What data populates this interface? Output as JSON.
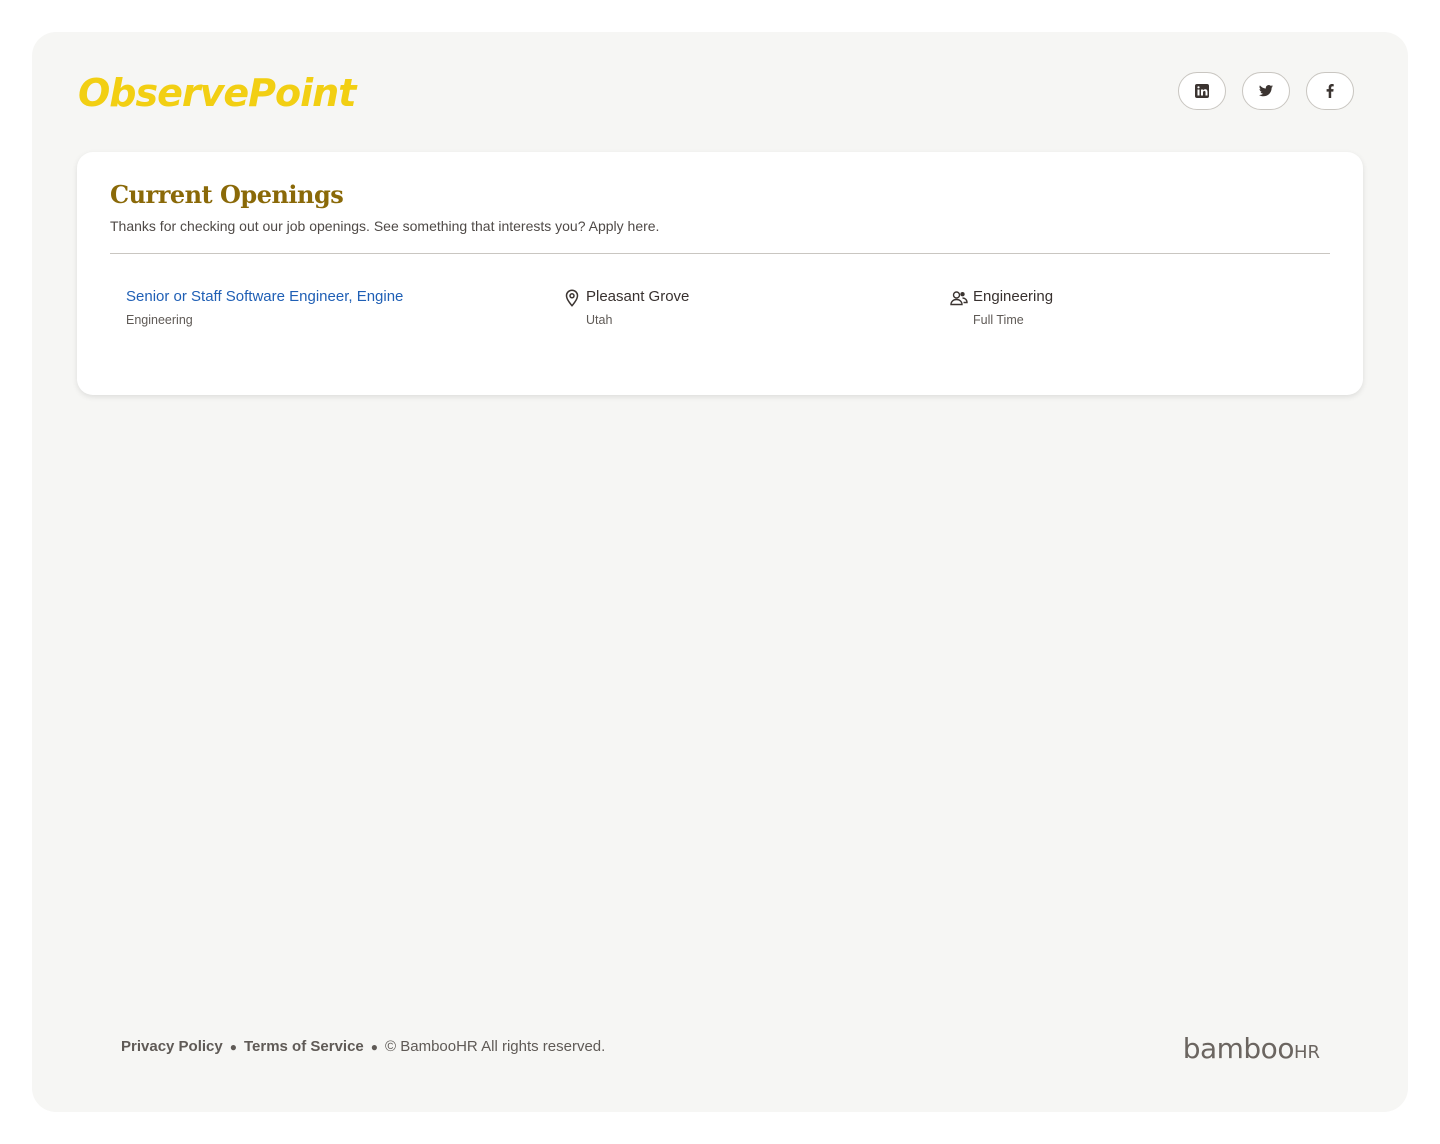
{
  "header": {
    "logo_text": "ObservePoint",
    "social": [
      {
        "name": "linkedin",
        "icon": "linkedin-icon"
      },
      {
        "name": "twitter",
        "icon": "twitter-icon"
      },
      {
        "name": "facebook",
        "icon": "facebook-icon"
      }
    ]
  },
  "openings": {
    "title": "Current Openings",
    "subtitle": "Thanks for checking out our job openings. See something that interests you? Apply here.",
    "jobs": [
      {
        "title": "Senior or Staff Software Engineer, Engine",
        "department": "Engineering",
        "city": "Pleasant Grove",
        "state": "Utah",
        "team": "Engineering",
        "employment_type": "Full Time"
      }
    ]
  },
  "footer": {
    "privacy": "Privacy Policy",
    "terms": "Terms of Service",
    "copyright": "© BambooHR All rights reserved.",
    "brand": "bamboo",
    "brand_suffix": "HR"
  },
  "colors": {
    "logo": "#f2cf13",
    "title": "#8a6908",
    "link": "#1f5fb5",
    "background": "#f6f6f4"
  }
}
